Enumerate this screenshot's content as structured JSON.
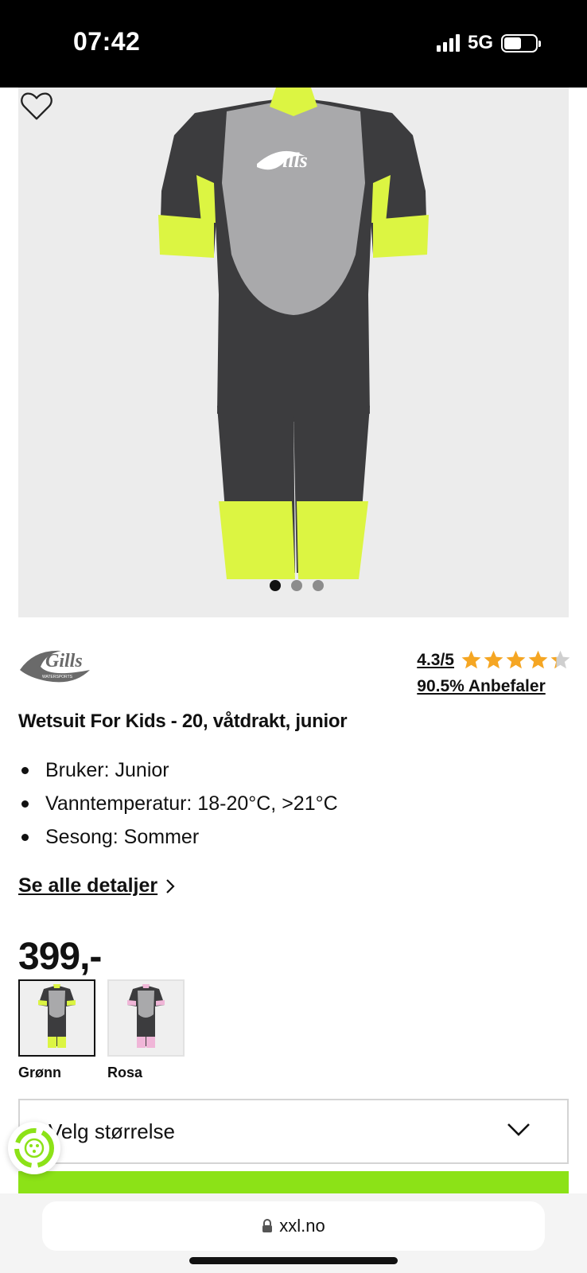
{
  "status_bar": {
    "time": "07:42",
    "network": "5G"
  },
  "product": {
    "brand": "Gills",
    "brand_sub": "WATERSPORTS",
    "title": "Wetsuit For Kids - 20, våtdrakt, junior",
    "rating": {
      "value": "4.3/5",
      "stars": 4.3,
      "recommend": "90.5% Anbefaler"
    },
    "features": [
      "Bruker: Junior",
      "Vanntemperatur: 18-20°C, >21°C",
      "Sesong: Sommer"
    ],
    "details_link": "Se alle detaljer",
    "price": "399,-",
    "image_carousel": {
      "total": 3,
      "active": 1
    },
    "variants": [
      {
        "label": "Grønn",
        "accent": "#dcf542",
        "selected": true
      },
      {
        "label": "Rosa",
        "accent": "#f0b6d8",
        "selected": false
      }
    ],
    "size_select": {
      "placeholder": "Velg størrelse"
    }
  },
  "colors": {
    "cta": "#8ce217",
    "star": "#f5a623",
    "suit_dark": "#3c3c3e",
    "suit_panel": "#a9a9ab",
    "suit_accent": "#dcf542"
  },
  "browser": {
    "url": "xxl.no"
  }
}
